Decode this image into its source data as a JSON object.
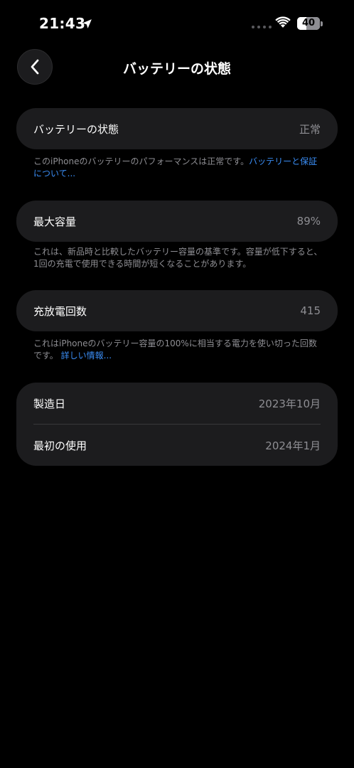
{
  "status_bar": {
    "time": "21:43",
    "battery_level": "40"
  },
  "nav": {
    "title": "バッテリーの状態"
  },
  "battery_state": {
    "label": "バッテリーの状態",
    "value": "正常",
    "note": "このiPhoneのバッテリーのパフォーマンスは正常です。",
    "link": "バッテリーと保証について..."
  },
  "max_capacity": {
    "label": "最大容量",
    "value": "89%",
    "note": "これは、新品時と比較したバッテリー容量の基準です。容量が低下すると、1回の充電で使用できる時間が短くなることがあります。"
  },
  "cycle_count": {
    "label": "充放電回数",
    "value": "415",
    "note": "これはiPhoneのバッテリー容量の100%に相当する電力を使い切った回数です。",
    "link": "詳しい情報..."
  },
  "dates": {
    "manufacture_label": "製造日",
    "manufacture_value": "2023年10月",
    "first_use_label": "最初の使用",
    "first_use_value": "2024年1月"
  },
  "colors": {
    "background": "#000000",
    "card": "#1c1c1e",
    "secondary_text": "#8e8e93",
    "link": "#3a8df5"
  }
}
